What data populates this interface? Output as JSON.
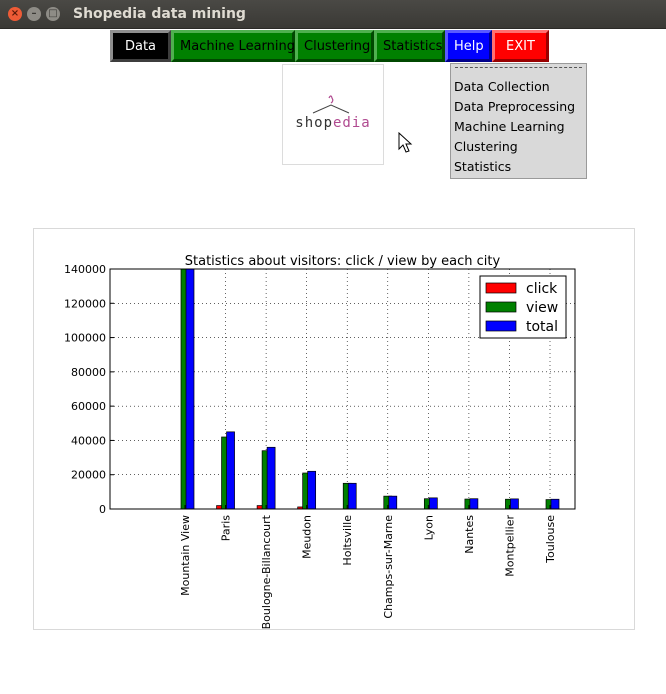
{
  "window": {
    "title": "Shopedia data mining"
  },
  "menubar": {
    "data_label": "Data",
    "ml_label": "Machine Learning",
    "clustering_label": "Clustering",
    "statistics_label": "Statistics",
    "help_label": "Help",
    "exit_label": "EXIT"
  },
  "dropdown": {
    "items": [
      "Data Collection",
      "Data Preprocessing",
      "Machine Learning",
      "Clustering",
      "Statistics"
    ]
  },
  "logo": {
    "text_shop": "shop",
    "text_edia": "edia"
  },
  "colors": {
    "data_btn": "#000000",
    "green_btn": "#008000",
    "help_btn": "#0000ff",
    "exit_btn": "#ff0000",
    "click": "#ff0000",
    "view": "#008000",
    "total": "#0000ff"
  },
  "chart_data": {
    "type": "bar",
    "title": "Statistics about visitors: click / view by each city",
    "categories": [
      "Mountain View",
      "Paris",
      "Boulogne-Billancourt",
      "Meudon",
      "Holtsville",
      "Champs-sur-Marne",
      "Lyon",
      "Nantes",
      "Montpellier",
      "Toulouse"
    ],
    "series": [
      {
        "name": "click",
        "color": "#ff0000",
        "values": [
          0,
          2000,
          2000,
          1200,
          0,
          0,
          0,
          0,
          0,
          0
        ]
      },
      {
        "name": "view",
        "color": "#008000",
        "values": [
          140000,
          42000,
          34000,
          21000,
          15000,
          7500,
          6000,
          5800,
          5700,
          5500
        ]
      },
      {
        "name": "total",
        "color": "#0000ff",
        "values": [
          140000,
          45000,
          36000,
          22000,
          15000,
          7500,
          6500,
          6000,
          5900,
          5700
        ]
      }
    ],
    "ylim": [
      0,
      140000
    ],
    "yticks": [
      "0",
      "20000",
      "40000",
      "60000",
      "80000",
      "100000",
      "120000",
      "140000"
    ],
    "grid": true,
    "legend_position": "top-right"
  }
}
